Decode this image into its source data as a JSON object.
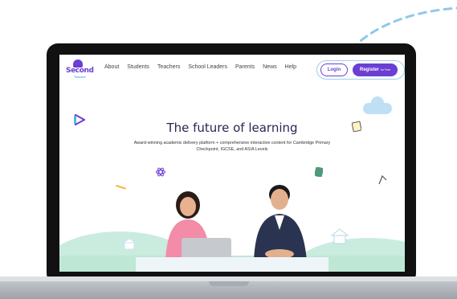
{
  "nav": {
    "logo_text": "Second",
    "logo_sub": "Teacher",
    "links": [
      "About",
      "Students",
      "Teachers",
      "School Leaders",
      "Parents",
      "News",
      "Help"
    ],
    "login_label": "Login",
    "register_label": "Register",
    "register_note": "for Free"
  },
  "hero": {
    "title": "The future of learning",
    "subtitle": "Award-winning academic delivery platform + comprehensive interactive content for Cambridge Primary Checkpoint, IGCSE, and AS/A Levels"
  },
  "colors": {
    "brand_purple": "#6a3fd1",
    "cta_outline": "#9bd0ef",
    "hill_green": "#c9ecdf"
  },
  "icons": [
    "triangle-ruler-icon",
    "cloud-icon",
    "notepad-icon",
    "atom-icon",
    "calculator-icon",
    "compass-icon",
    "pencil-icon"
  ]
}
